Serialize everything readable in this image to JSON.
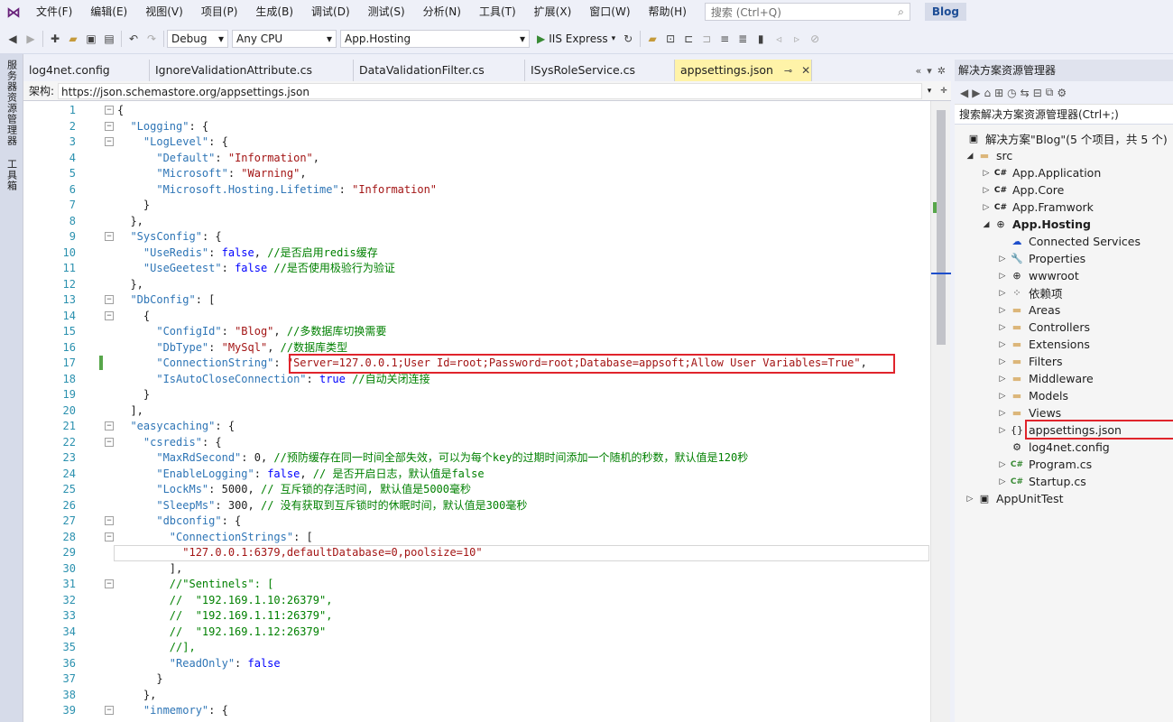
{
  "menu": {
    "items": [
      "文件(F)",
      "编辑(E)",
      "视图(V)",
      "项目(P)",
      "生成(B)",
      "调试(D)",
      "测试(S)",
      "分析(N)",
      "工具(T)",
      "扩展(X)",
      "窗口(W)",
      "帮助(H)"
    ],
    "search_placeholder": "搜索 (Ctrl+Q)",
    "solution_name": "Blog"
  },
  "toolbar": {
    "config": "Debug",
    "platform": "Any CPU",
    "startup_project": "App.Hosting",
    "run_label": "IIS Express"
  },
  "left_strip": {
    "server_explorer": "服务器资源管理器",
    "toolbox": "工具箱"
  },
  "tabs": [
    {
      "label": "log4net.config"
    },
    {
      "label": "IgnoreValidationAttribute.cs"
    },
    {
      "label": "DataValidationFilter.cs"
    },
    {
      "label": "ISysRoleService.cs"
    },
    {
      "label": "appsettings.json",
      "active": true
    }
  ],
  "schema": {
    "label": "架构:",
    "url": "https://json.schemastore.org/appsettings.json"
  },
  "editor": {
    "lines": [
      {
        "n": "1",
        "code": "{"
      },
      {
        "n": "2",
        "code": "  \"Logging\": {"
      },
      {
        "n": "3",
        "code": "    \"LogLevel\": {"
      },
      {
        "n": "4",
        "code": "      \"Default\": \"Information\","
      },
      {
        "n": "5",
        "code": "      \"Microsoft\": \"Warning\","
      },
      {
        "n": "6",
        "code": "      \"Microsoft.Hosting.Lifetime\": \"Information\""
      },
      {
        "n": "7",
        "code": "    }"
      },
      {
        "n": "8",
        "code": "  },"
      },
      {
        "n": "9",
        "code": "  \"SysConfig\": {"
      },
      {
        "n": "10",
        "code": "    \"UseRedis\": false, //是否启用redis缓存"
      },
      {
        "n": "11",
        "code": "    \"UseGeetest\": false //是否使用极验行为验证"
      },
      {
        "n": "12",
        "code": "  },"
      },
      {
        "n": "13",
        "code": "  \"DbConfig\": ["
      },
      {
        "n": "14",
        "code": "    {"
      },
      {
        "n": "15",
        "code": "      \"ConfigId\": \"Blog\", //多数据库切换需要"
      },
      {
        "n": "16",
        "code": "      \"DbType\": \"MySql\", //数据库类型"
      },
      {
        "n": "17",
        "code": "      \"ConnectionString\": \"Server=127.0.0.1;User Id=root;Password=root;Database=appsoft;Allow User Variables=True\","
      },
      {
        "n": "18",
        "code": "      \"IsAutoCloseConnection\": true //自动关闭连接"
      },
      {
        "n": "19",
        "code": "    }"
      },
      {
        "n": "20",
        "code": "  ],"
      },
      {
        "n": "21",
        "code": "  \"easycaching\": {"
      },
      {
        "n": "22",
        "code": "    \"csredis\": {"
      },
      {
        "n": "23",
        "code": "      \"MaxRdSecond\": 0, //预防缓存在同一时间全部失效，可以为每个key的过期时间添加一个随机的秒数，默认值是120秒"
      },
      {
        "n": "24",
        "code": "      \"EnableLogging\": false, // 是否开启日志，默认值是false"
      },
      {
        "n": "25",
        "code": "      \"LockMs\": 5000, // 互斥锁的存活时间, 默认值是5000毫秒"
      },
      {
        "n": "26",
        "code": "      \"SleepMs\": 300, // 没有获取到互斥锁时的休眠时间，默认值是300毫秒"
      },
      {
        "n": "27",
        "code": "      \"dbconfig\": {"
      },
      {
        "n": "28",
        "code": "        \"ConnectionStrings\": ["
      },
      {
        "n": "29",
        "code": "          \"127.0.0.1:6379,defaultDatabase=0,poolsize=10\""
      },
      {
        "n": "30",
        "code": "        ],"
      },
      {
        "n": "31",
        "code": "        //\"Sentinels\": ["
      },
      {
        "n": "32",
        "code": "        //  \"192.169.1.10:26379\","
      },
      {
        "n": "33",
        "code": "        //  \"192.169.1.11:26379\","
      },
      {
        "n": "34",
        "code": "        //  \"192.169.1.12:26379\""
      },
      {
        "n": "35",
        "code": "        //],"
      },
      {
        "n": "36",
        "code": "        \"ReadOnly\": false"
      },
      {
        "n": "37",
        "code": "      }"
      },
      {
        "n": "38",
        "code": "    },"
      },
      {
        "n": "39",
        "code": "    \"inmemory\": {"
      }
    ]
  },
  "solution_explorer": {
    "title": "解决方案资源管理器",
    "search_placeholder": "搜索解决方案资源管理器(Ctrl+;)",
    "solution_label": "解决方案\"Blog\"(5 个项目，共 5 个)",
    "items": [
      {
        "label": "src",
        "icon": "folder-icon"
      },
      {
        "label": "App.Application",
        "icon": "csproj-icon"
      },
      {
        "label": "App.Core",
        "icon": "csproj-icon"
      },
      {
        "label": "App.Framwork",
        "icon": "csproj-icon"
      },
      {
        "label": "App.Hosting",
        "icon": "webproj-icon"
      },
      {
        "label": "Connected Services",
        "icon": "connected-services-icon"
      },
      {
        "label": "Properties",
        "icon": "properties-icon"
      },
      {
        "label": "wwwroot",
        "icon": "globe-icon"
      },
      {
        "label": "依赖项",
        "icon": "dependencies-icon"
      },
      {
        "label": "Areas",
        "icon": "folder-icon"
      },
      {
        "label": "Controllers",
        "icon": "folder-icon"
      },
      {
        "label": "Extensions",
        "icon": "folder-icon"
      },
      {
        "label": "Filters",
        "icon": "folder-icon"
      },
      {
        "label": "Middleware",
        "icon": "folder-icon"
      },
      {
        "label": "Models",
        "icon": "folder-icon"
      },
      {
        "label": "Views",
        "icon": "folder-icon"
      },
      {
        "label": "appsettings.json",
        "icon": "json-icon"
      },
      {
        "label": "log4net.config",
        "icon": "config-icon"
      },
      {
        "label": "Program.cs",
        "icon": "csharp-icon"
      },
      {
        "label": "Startup.cs",
        "icon": "csharp-icon"
      },
      {
        "label": "AppUnitTest",
        "icon": "test-project-icon"
      }
    ]
  },
  "colors": {
    "highlight": "#e0242c",
    "active_tab": "#fff3a8",
    "accent": "#68217a"
  }
}
